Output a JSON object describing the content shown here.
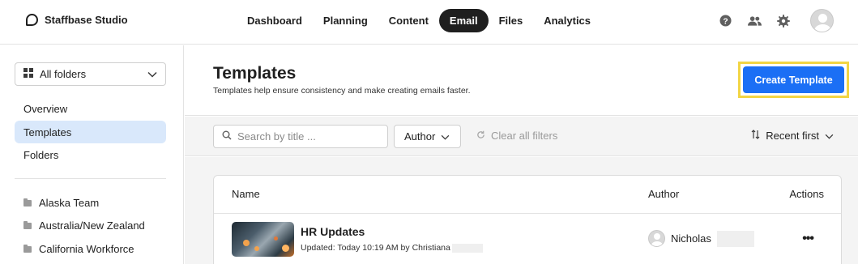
{
  "brand": {
    "name": "Staffbase Studio"
  },
  "nav": [
    {
      "label": "Dashboard"
    },
    {
      "label": "Planning"
    },
    {
      "label": "Content"
    },
    {
      "label": "Email",
      "active": true
    },
    {
      "label": "Files"
    },
    {
      "label": "Analytics"
    }
  ],
  "top_icons": [
    "help-icon",
    "people-icon",
    "gear-icon",
    "avatar"
  ],
  "sidebar": {
    "folder_select": "All folders",
    "links": [
      {
        "label": "Overview"
      },
      {
        "label": "Templates",
        "active": true
      },
      {
        "label": "Folders"
      }
    ],
    "folders": [
      {
        "label": "Alaska Team"
      },
      {
        "label": "Australia/New Zealand"
      },
      {
        "label": "California Workforce"
      }
    ]
  },
  "header": {
    "title": "Templates",
    "subtitle": "Templates help ensure consistency and make creating emails faster.",
    "create_button": "Create Template"
  },
  "filters": {
    "search_placeholder": "Search by title ...",
    "author_label": "Author",
    "clear_label": "Clear all filters",
    "sort_label": "Recent first"
  },
  "table": {
    "columns": {
      "name": "Name",
      "author": "Author",
      "actions": "Actions"
    },
    "rows": [
      {
        "title": "HR Updates",
        "meta": "Updated: Today 10:19 AM by Christiana",
        "author": "Nicholas",
        "actions": "•••"
      }
    ]
  },
  "colors": {
    "accent": "#1b6ff5",
    "highlight": "#f2d544",
    "active_nav": "#1f1f1f",
    "sidebar_active": "#d9e8fb"
  }
}
